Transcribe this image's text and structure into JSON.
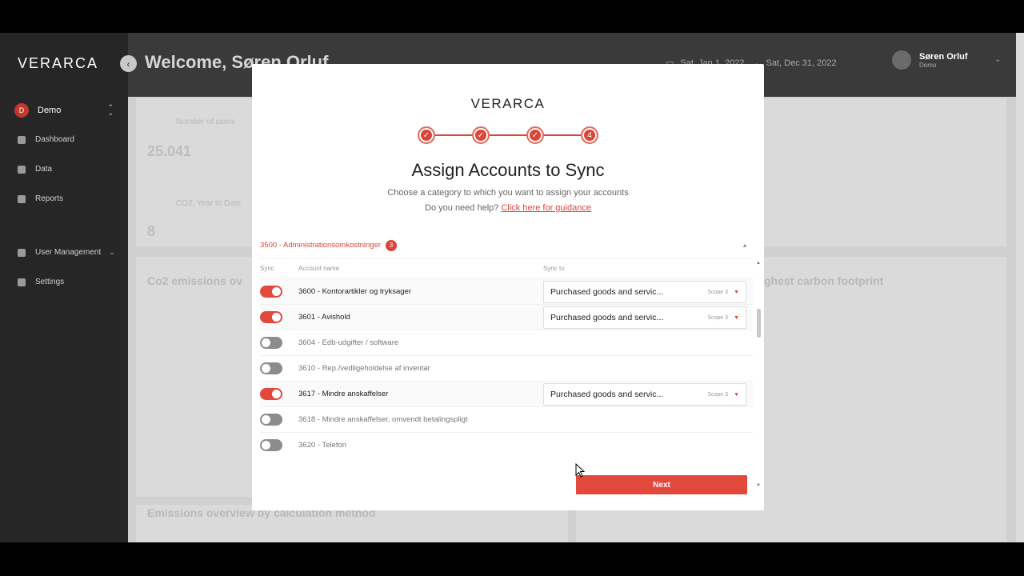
{
  "app": {
    "logo": "VERARCA",
    "org_name": "Demo",
    "org_initial": "D"
  },
  "sidebar": {
    "items": [
      {
        "label": "Dashboard"
      },
      {
        "label": "Data"
      },
      {
        "label": "Reports"
      },
      {
        "label": "User Management"
      },
      {
        "label": "Settings"
      }
    ]
  },
  "header": {
    "welcome": "Welcome, Søren Orluf",
    "date_from": "Sat, Jan 1, 2022",
    "date_to": "Sat, Dec 31, 2022",
    "user_name": "Søren Orluf",
    "user_org": "Demo"
  },
  "background": {
    "card1_label": "Number of users",
    "card1_value": "25.041",
    "card2_label": "CO2, Year to Date",
    "card2_value": "8",
    "chart_title": "Co2 emissions ov",
    "table_title": "ghest carbon footprint",
    "bottom_title": "Emissions overview by calculation method"
  },
  "modal": {
    "logo": "VERARCA",
    "steps": [
      "✓",
      "✓",
      "✓",
      "4"
    ],
    "title": "Assign Accounts to Sync",
    "subtitle": "Choose a category to which you want to assign your accounts",
    "help_prefix": "Do you need help?",
    "help_link": "Click here for guidance",
    "section_label": "3500 - Administrationsomkostninger",
    "section_count": "3",
    "col_sync": "Sync",
    "col_account": "Account name",
    "col_sync_to": "Sync to",
    "rows": [
      {
        "name": "3600 - Kontorartikler og tryksager",
        "on": true,
        "sync_to": "Purchased goods and servic...",
        "scope": "Scope 3"
      },
      {
        "name": "3601 - Avishold",
        "on": true,
        "sync_to": "Purchased goods and servic...",
        "scope": "Scope 3"
      },
      {
        "name": "3604 - Edb-udgifter / software",
        "on": false
      },
      {
        "name": "3610 - Rep./vedligeholdelse af inventar",
        "on": false
      },
      {
        "name": "3617 - Mindre anskaffelser",
        "on": true,
        "sync_to": "Purchased goods and servic...",
        "scope": "Scope 3"
      },
      {
        "name": "3618 - Mindre anskaffelser, omvendt betalingspligt",
        "on": false
      },
      {
        "name": "3620 - Telefon",
        "on": false
      }
    ],
    "next_label": "Next"
  },
  "colors": {
    "accent": "#e2483b",
    "sidebar_bg": "#262626"
  }
}
